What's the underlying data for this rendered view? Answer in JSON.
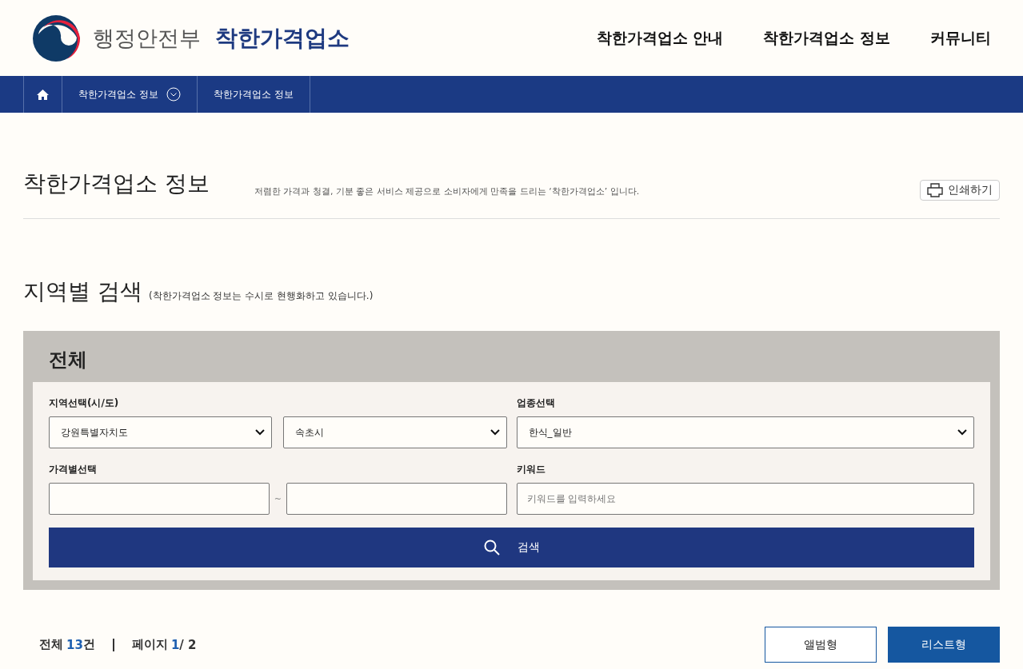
{
  "header": {
    "ministry": "행정안전부",
    "brand": "착한가격업소",
    "menu": [
      {
        "label": "착한가격업소 안내"
      },
      {
        "label": "착한가격업소 정보"
      },
      {
        "label": "커뮤니티"
      }
    ]
  },
  "breadcrumb": [
    {
      "label": "착한가격업소 정보",
      "dropdown": true
    },
    {
      "label": "착한가격업소 정보",
      "dropdown": false
    }
  ],
  "page": {
    "title": "착한가격업소 정보",
    "description": "저렴한 가격과 청결, 기분 좋은 서비스 제공으로 소비자에게 만족을 드리는 ‘착한가격업소’ 입니다.",
    "print_button": "인쇄하기"
  },
  "search": {
    "heading": "지역별 검색",
    "note": "(착한가격업소 정보는 수시로 현행화하고 있습니다.)",
    "panel_title": "전체",
    "region_label": "지역선택(시/도)",
    "province": "강원특별자치도",
    "city": "속초시",
    "category_label": "업종선택",
    "category": "한식_일반",
    "price_label": "가격별선택",
    "price_separator": "~",
    "keyword_label": "키워드",
    "keyword_placeholder": "키워드를 입력하세요",
    "button": "검색"
  },
  "results": {
    "total_label": "전체",
    "total_count": "13",
    "total_unit": "건",
    "page_label": "페이지",
    "page_current": "1",
    "page_total": "/ 2",
    "views": [
      {
        "label": "앨범형",
        "selected": false
      },
      {
        "label": "리스트형",
        "selected": true
      }
    ]
  }
}
